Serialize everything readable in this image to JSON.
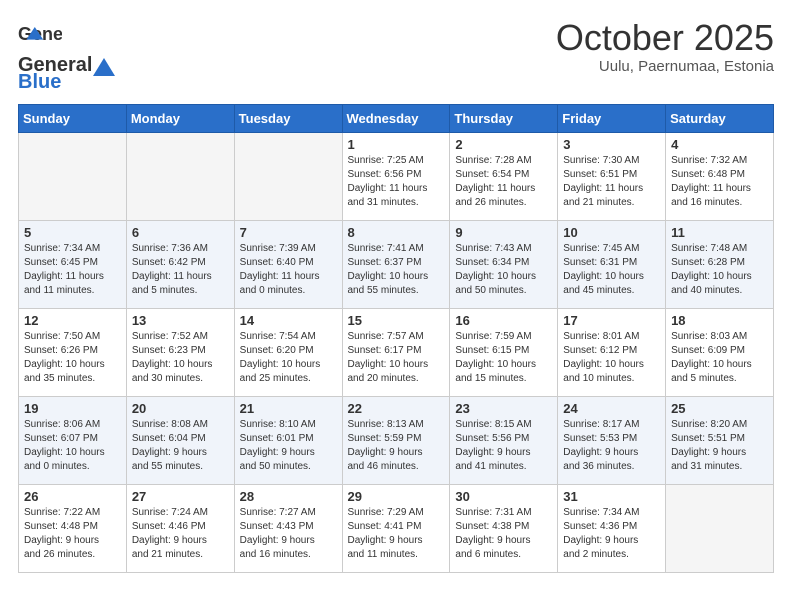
{
  "header": {
    "logo_general": "General",
    "logo_blue": "Blue",
    "month_year": "October 2025",
    "location": "Uulu, Paernumaa, Estonia"
  },
  "days_of_week": [
    "Sunday",
    "Monday",
    "Tuesday",
    "Wednesday",
    "Thursday",
    "Friday",
    "Saturday"
  ],
  "weeks": [
    [
      {
        "num": "",
        "info": ""
      },
      {
        "num": "",
        "info": ""
      },
      {
        "num": "",
        "info": ""
      },
      {
        "num": "1",
        "info": "Sunrise: 7:25 AM\nSunset: 6:56 PM\nDaylight: 11 hours\nand 31 minutes."
      },
      {
        "num": "2",
        "info": "Sunrise: 7:28 AM\nSunset: 6:54 PM\nDaylight: 11 hours\nand 26 minutes."
      },
      {
        "num": "3",
        "info": "Sunrise: 7:30 AM\nSunset: 6:51 PM\nDaylight: 11 hours\nand 21 minutes."
      },
      {
        "num": "4",
        "info": "Sunrise: 7:32 AM\nSunset: 6:48 PM\nDaylight: 11 hours\nand 16 minutes."
      }
    ],
    [
      {
        "num": "5",
        "info": "Sunrise: 7:34 AM\nSunset: 6:45 PM\nDaylight: 11 hours\nand 11 minutes."
      },
      {
        "num": "6",
        "info": "Sunrise: 7:36 AM\nSunset: 6:42 PM\nDaylight: 11 hours\nand 5 minutes."
      },
      {
        "num": "7",
        "info": "Sunrise: 7:39 AM\nSunset: 6:40 PM\nDaylight: 11 hours\nand 0 minutes."
      },
      {
        "num": "8",
        "info": "Sunrise: 7:41 AM\nSunset: 6:37 PM\nDaylight: 10 hours\nand 55 minutes."
      },
      {
        "num": "9",
        "info": "Sunrise: 7:43 AM\nSunset: 6:34 PM\nDaylight: 10 hours\nand 50 minutes."
      },
      {
        "num": "10",
        "info": "Sunrise: 7:45 AM\nSunset: 6:31 PM\nDaylight: 10 hours\nand 45 minutes."
      },
      {
        "num": "11",
        "info": "Sunrise: 7:48 AM\nSunset: 6:28 PM\nDaylight: 10 hours\nand 40 minutes."
      }
    ],
    [
      {
        "num": "12",
        "info": "Sunrise: 7:50 AM\nSunset: 6:26 PM\nDaylight: 10 hours\nand 35 minutes."
      },
      {
        "num": "13",
        "info": "Sunrise: 7:52 AM\nSunset: 6:23 PM\nDaylight: 10 hours\nand 30 minutes."
      },
      {
        "num": "14",
        "info": "Sunrise: 7:54 AM\nSunset: 6:20 PM\nDaylight: 10 hours\nand 25 minutes."
      },
      {
        "num": "15",
        "info": "Sunrise: 7:57 AM\nSunset: 6:17 PM\nDaylight: 10 hours\nand 20 minutes."
      },
      {
        "num": "16",
        "info": "Sunrise: 7:59 AM\nSunset: 6:15 PM\nDaylight: 10 hours\nand 15 minutes."
      },
      {
        "num": "17",
        "info": "Sunrise: 8:01 AM\nSunset: 6:12 PM\nDaylight: 10 hours\nand 10 minutes."
      },
      {
        "num": "18",
        "info": "Sunrise: 8:03 AM\nSunset: 6:09 PM\nDaylight: 10 hours\nand 5 minutes."
      }
    ],
    [
      {
        "num": "19",
        "info": "Sunrise: 8:06 AM\nSunset: 6:07 PM\nDaylight: 10 hours\nand 0 minutes."
      },
      {
        "num": "20",
        "info": "Sunrise: 8:08 AM\nSunset: 6:04 PM\nDaylight: 9 hours\nand 55 minutes."
      },
      {
        "num": "21",
        "info": "Sunrise: 8:10 AM\nSunset: 6:01 PM\nDaylight: 9 hours\nand 50 minutes."
      },
      {
        "num": "22",
        "info": "Sunrise: 8:13 AM\nSunset: 5:59 PM\nDaylight: 9 hours\nand 46 minutes."
      },
      {
        "num": "23",
        "info": "Sunrise: 8:15 AM\nSunset: 5:56 PM\nDaylight: 9 hours\nand 41 minutes."
      },
      {
        "num": "24",
        "info": "Sunrise: 8:17 AM\nSunset: 5:53 PM\nDaylight: 9 hours\nand 36 minutes."
      },
      {
        "num": "25",
        "info": "Sunrise: 8:20 AM\nSunset: 5:51 PM\nDaylight: 9 hours\nand 31 minutes."
      }
    ],
    [
      {
        "num": "26",
        "info": "Sunrise: 7:22 AM\nSunset: 4:48 PM\nDaylight: 9 hours\nand 26 minutes."
      },
      {
        "num": "27",
        "info": "Sunrise: 7:24 AM\nSunset: 4:46 PM\nDaylight: 9 hours\nand 21 minutes."
      },
      {
        "num": "28",
        "info": "Sunrise: 7:27 AM\nSunset: 4:43 PM\nDaylight: 9 hours\nand 16 minutes."
      },
      {
        "num": "29",
        "info": "Sunrise: 7:29 AM\nSunset: 4:41 PM\nDaylight: 9 hours\nand 11 minutes."
      },
      {
        "num": "30",
        "info": "Sunrise: 7:31 AM\nSunset: 4:38 PM\nDaylight: 9 hours\nand 6 minutes."
      },
      {
        "num": "31",
        "info": "Sunrise: 7:34 AM\nSunset: 4:36 PM\nDaylight: 9 hours\nand 2 minutes."
      },
      {
        "num": "",
        "info": ""
      }
    ]
  ]
}
